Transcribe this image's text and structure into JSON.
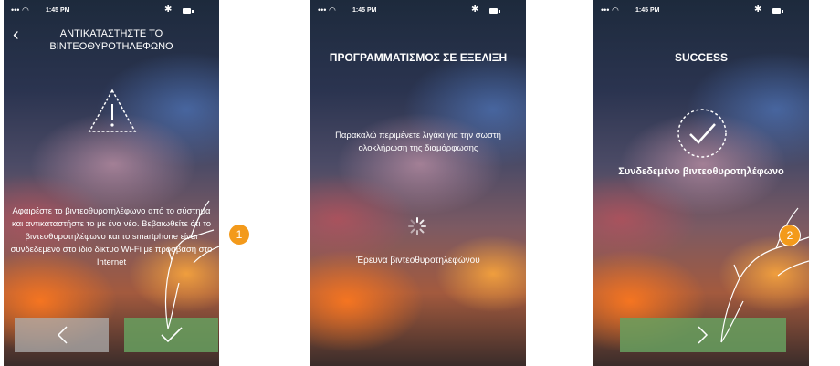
{
  "status_bar": {
    "time": "1:45 PM",
    "signal": "••• ",
    "bluetooth": "✱"
  },
  "screen1": {
    "title": "ΑΝΤΙΚΑΤΑΣΤΗΣΤΕ ΤΟ ΒΙΝΤΕΟΘΥΡΟΤΗΛΕΦΩΝΟ",
    "instructions": "Αφαιρέστε το βιντεοθυροτηλέφωνο από το σύστημα και αντικαταστήστε το με ένα νέο. Βεβαιωθείτε ότι το βιντεοθυροτηλέφωνο και το smartphone είναι συνδεδεμένο στο ίδιο δίκτυο Wi-Fi με πρόσβαση στο Internet",
    "back_icon": "chevron-left-icon",
    "warning_icon": "warning-triangle-icon"
  },
  "screen2": {
    "title": "ΠΡΟΓΡΑΜΜΑΤΙΣΜΟΣ ΣΕ ΕΞΕΛΙΞΗ",
    "message": "Παρακαλώ περιμένετε λιγάκι για την σωστή ολοκλήρωση της διαμόρφωσης",
    "status": "Έρευνα βιντεοθυροτηλεφώνου",
    "spinner_icon": "loading-spinner-icon"
  },
  "screen3": {
    "title": "SUCCESS",
    "message": "Συνδεδεμένο βιντεοθυροτηλέφωνο",
    "check_icon": "check-circle-icon"
  },
  "callouts": {
    "one": "1",
    "two": "2"
  },
  "colors": {
    "accent_green": "#67a05f",
    "badge_orange": "#f39a1b",
    "back_grey": "#afafaf"
  }
}
